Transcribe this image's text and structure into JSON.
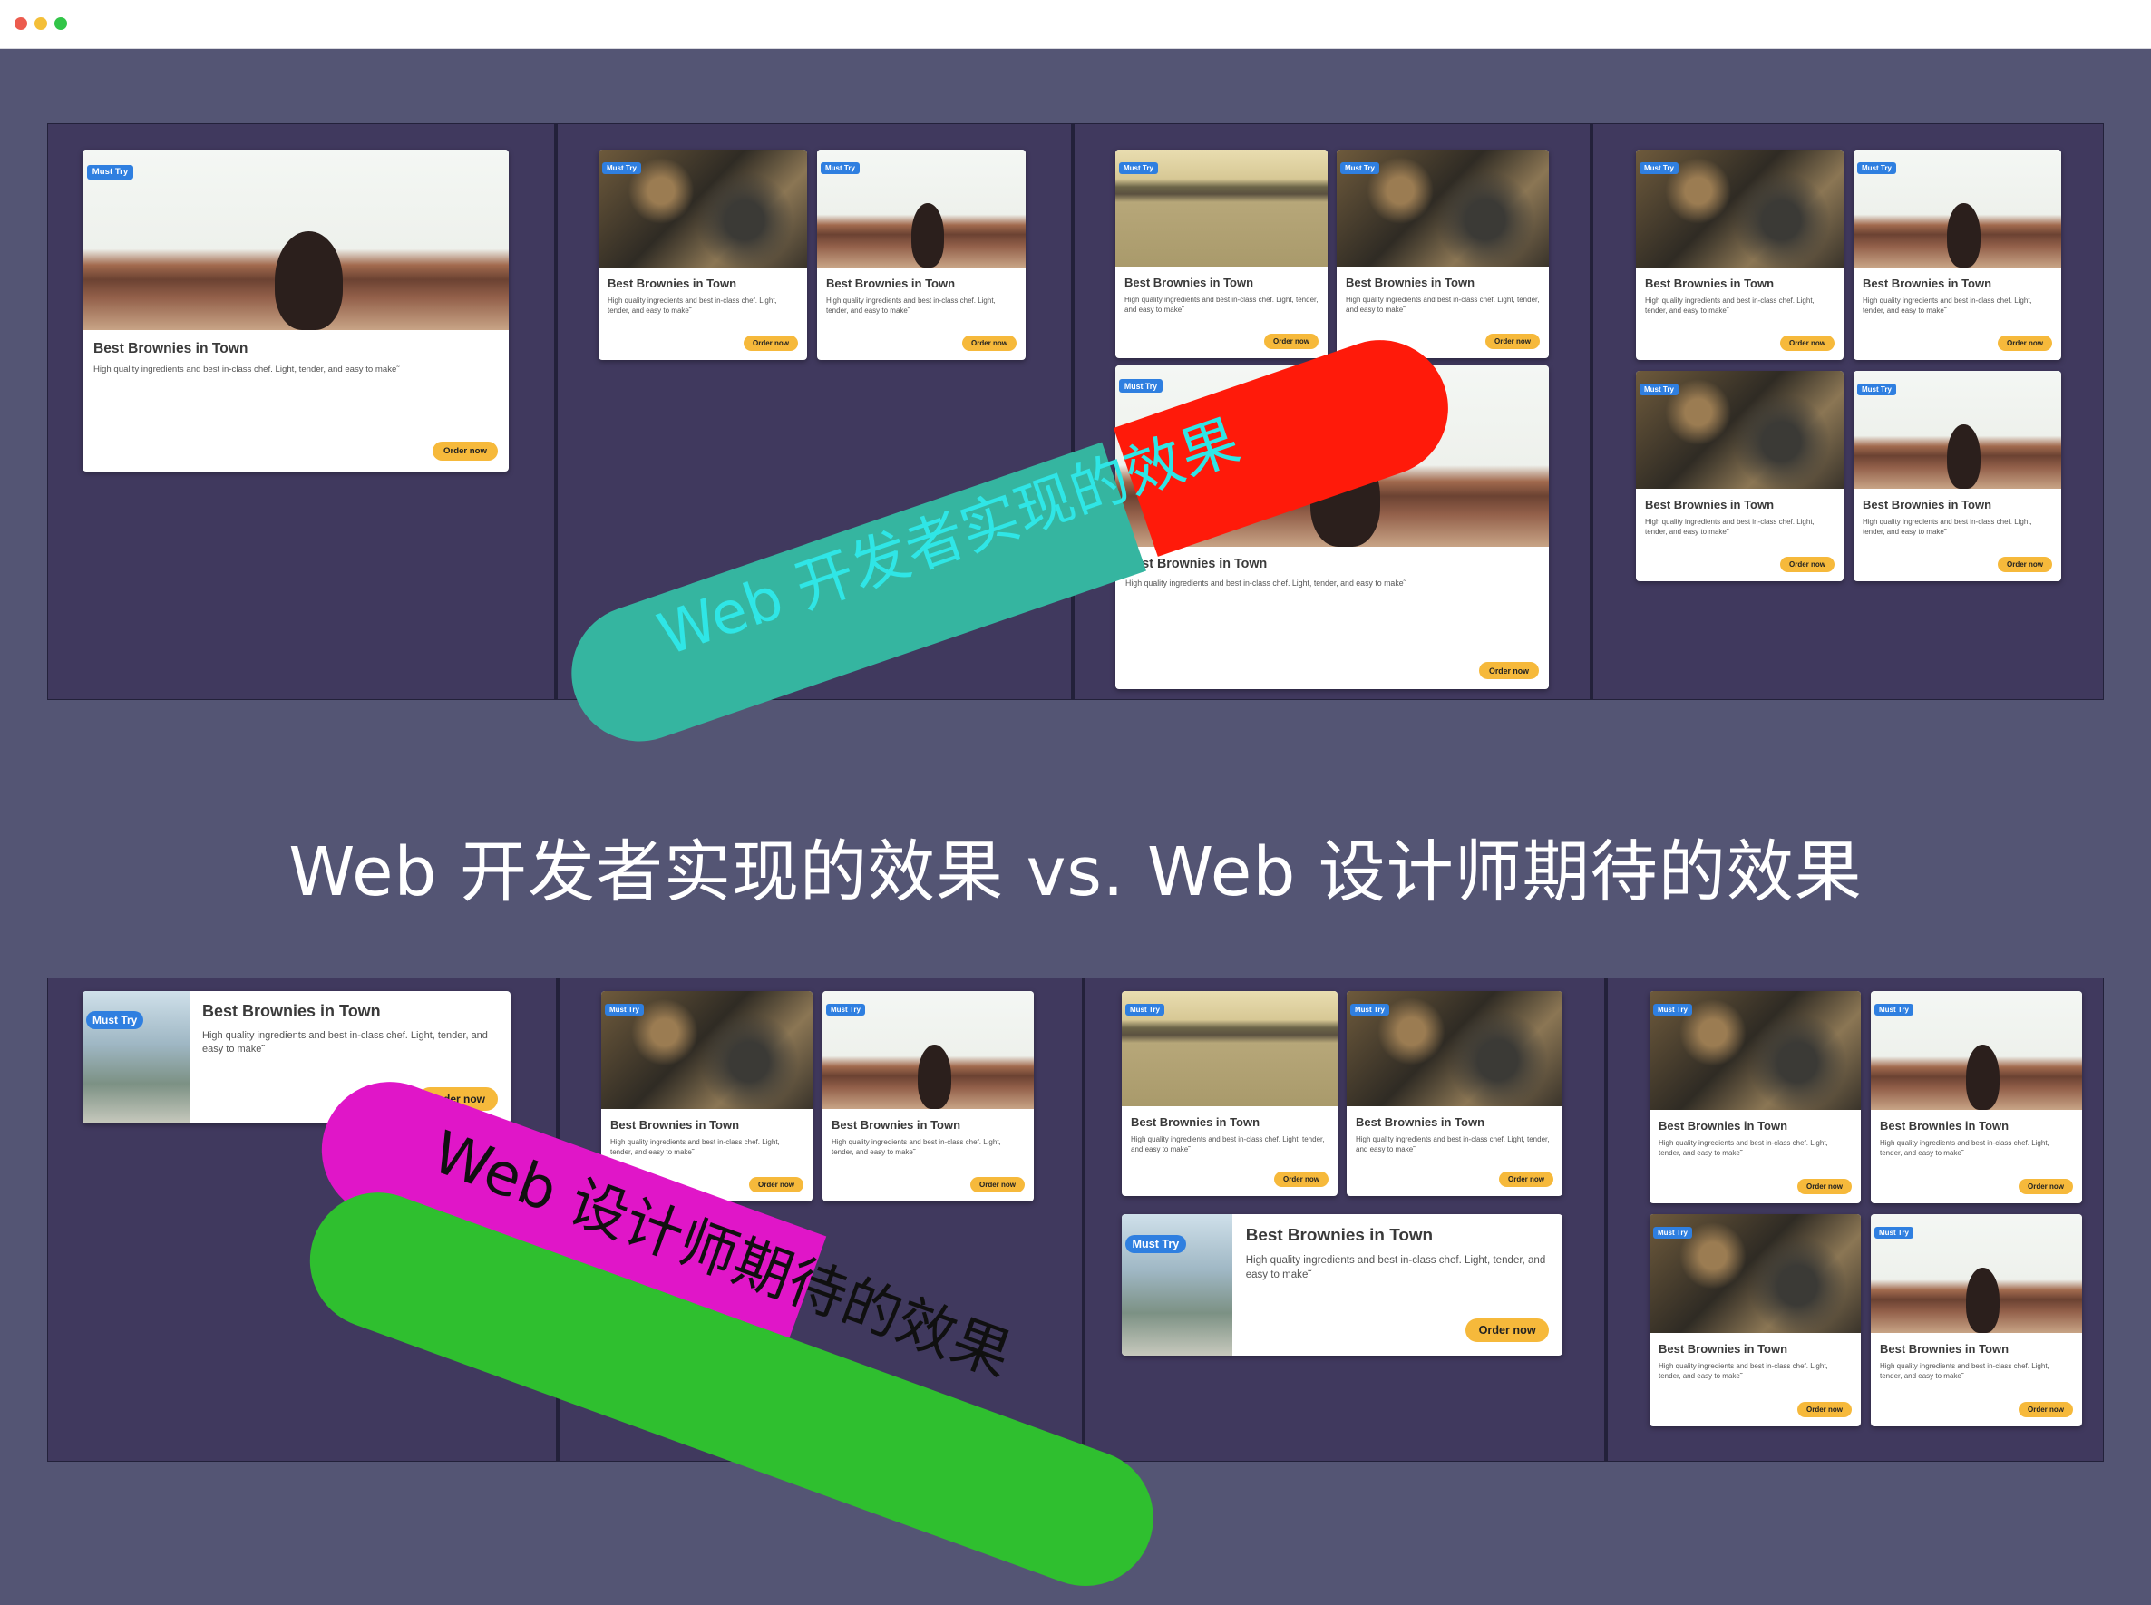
{
  "window": {
    "controls": [
      "close",
      "minimize",
      "maximize"
    ],
    "colors": {
      "close": "#ec5b4e",
      "minimize": "#f4bf38",
      "maximize": "#32c548"
    }
  },
  "card": {
    "badge": "Must Try",
    "title": "Best Brownies in Town",
    "description": "High quality ingredients and best in-class chef. Light, tender, and easy to make˜",
    "button": "Order now"
  },
  "title": "Web 开发者实现的效果 vs. Web 设计师期待的效果",
  "overlay_developer": "Web 开发者实现的效果",
  "overlay_designer": "Web 设计师期待的效果",
  "colors": {
    "background": "#545574",
    "panel": "#40395e",
    "badge": "#2f7fe0",
    "button": "#f6b93b",
    "overlay_teal": "#35b5a0",
    "overlay_red": "#ff1a0a",
    "overlay_green": "#2fbf2f",
    "overlay_magenta": "#e016c8"
  }
}
